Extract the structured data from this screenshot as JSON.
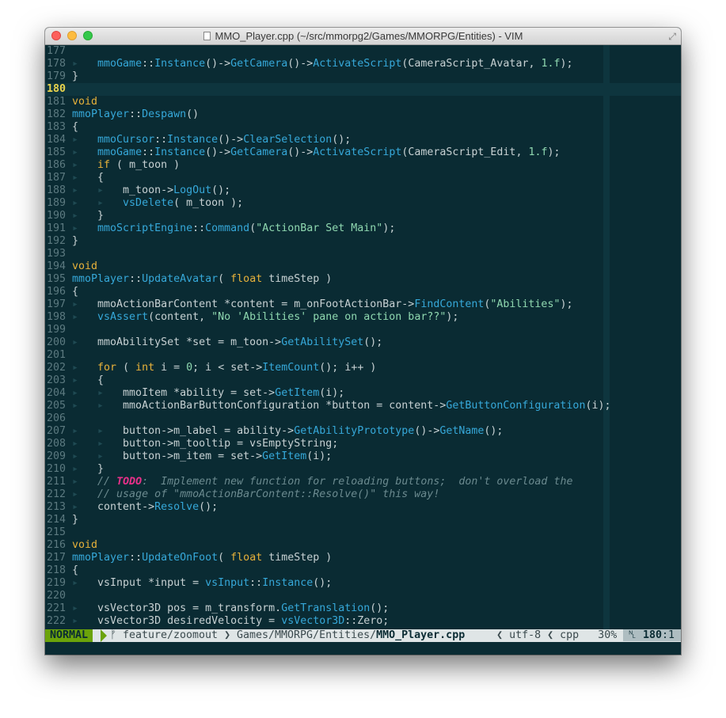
{
  "window": {
    "title": "MMO_Player.cpp (~/src/mmorpg2/Games/MMORPG/Entities) - VIM"
  },
  "icons": {
    "file": "document-icon",
    "fullscreen": "fullscreen-icon",
    "branch": "git-branch-icon",
    "line_number": "line-number-icon"
  },
  "colors": {
    "background": "#0a2b33",
    "keyword": "#e8b23a",
    "identifier": "#36a8d9",
    "string": "#8fd8b0",
    "comment": "#6b8a8f",
    "todo": "#e8308a",
    "mode_normal": "#6ba30a",
    "current_line_number": "#e8d44d"
  },
  "editor": {
    "current_line": 180,
    "lines": [
      {
        "n": "177",
        "t": []
      },
      {
        "n": "178",
        "t": [
          [
            "g",
            "▸   "
          ],
          [
            "cl",
            "mmoGame"
          ],
          [
            "op",
            "::"
          ],
          [
            "fn",
            "Instance"
          ],
          [
            "op",
            "()->"
          ],
          [
            "fn",
            "GetCamera"
          ],
          [
            "op",
            "()->"
          ],
          [
            "fn",
            "ActivateScript"
          ],
          [
            "op",
            "(CameraScript_Avatar, "
          ],
          [
            "numl",
            "1.f"
          ],
          [
            "op",
            ");"
          ]
        ]
      },
      {
        "n": "179",
        "t": [
          [
            "op",
            "}"
          ]
        ]
      },
      {
        "n": "180",
        "t": []
      },
      {
        "n": "181",
        "t": [
          [
            "ty",
            "void"
          ]
        ]
      },
      {
        "n": "182",
        "t": [
          [
            "cl",
            "mmoPlayer"
          ],
          [
            "op",
            "::"
          ],
          [
            "fn",
            "Despawn"
          ],
          [
            "op",
            "()"
          ]
        ]
      },
      {
        "n": "183",
        "t": [
          [
            "op",
            "{"
          ]
        ]
      },
      {
        "n": "184",
        "t": [
          [
            "g",
            "▸   "
          ],
          [
            "cl",
            "mmoCursor"
          ],
          [
            "op",
            "::"
          ],
          [
            "fn",
            "Instance"
          ],
          [
            "op",
            "()->"
          ],
          [
            "fn",
            "ClearSelection"
          ],
          [
            "op",
            "();"
          ]
        ]
      },
      {
        "n": "185",
        "t": [
          [
            "g",
            "▸   "
          ],
          [
            "cl",
            "mmoGame"
          ],
          [
            "op",
            "::"
          ],
          [
            "fn",
            "Instance"
          ],
          [
            "op",
            "()->"
          ],
          [
            "fn",
            "GetCamera"
          ],
          [
            "op",
            "()->"
          ],
          [
            "fn",
            "ActivateScript"
          ],
          [
            "op",
            "(CameraScript_Edit, "
          ],
          [
            "numl",
            "1.f"
          ],
          [
            "op",
            ");"
          ]
        ]
      },
      {
        "n": "186",
        "t": [
          [
            "g",
            "▸   "
          ],
          [
            "kw",
            "if"
          ],
          [
            "op",
            " ( m_toon )"
          ]
        ]
      },
      {
        "n": "187",
        "t": [
          [
            "g",
            "▸   "
          ],
          [
            "op",
            "{"
          ]
        ]
      },
      {
        "n": "188",
        "t": [
          [
            "g",
            "▸   ▸   "
          ],
          [
            "op",
            "m_toon->"
          ],
          [
            "fn",
            "LogOut"
          ],
          [
            "op",
            "();"
          ]
        ]
      },
      {
        "n": "189",
        "t": [
          [
            "g",
            "▸   ▸   "
          ],
          [
            "fn",
            "vsDelete"
          ],
          [
            "op",
            "( m_toon );"
          ]
        ]
      },
      {
        "n": "190",
        "t": [
          [
            "g",
            "▸   "
          ],
          [
            "op",
            "}"
          ]
        ]
      },
      {
        "n": "191",
        "t": [
          [
            "g",
            "▸   "
          ],
          [
            "cl",
            "mmoScriptEngine"
          ],
          [
            "op",
            "::"
          ],
          [
            "fn",
            "Command"
          ],
          [
            "op",
            "("
          ],
          [
            "str",
            "\"ActionBar Set Main\""
          ],
          [
            "op",
            ");"
          ]
        ]
      },
      {
        "n": "192",
        "t": [
          [
            "op",
            "}"
          ]
        ]
      },
      {
        "n": "193",
        "t": []
      },
      {
        "n": "194",
        "t": [
          [
            "ty",
            "void"
          ]
        ]
      },
      {
        "n": "195",
        "t": [
          [
            "cl",
            "mmoPlayer"
          ],
          [
            "op",
            "::"
          ],
          [
            "fn",
            "UpdateAvatar"
          ],
          [
            "op",
            "( "
          ],
          [
            "ty",
            "float"
          ],
          [
            "op",
            " timeStep )"
          ]
        ]
      },
      {
        "n": "196",
        "t": [
          [
            "op",
            "{"
          ]
        ]
      },
      {
        "n": "197",
        "t": [
          [
            "g",
            "▸   "
          ],
          [
            "op",
            "mmoActionBarContent *content = m_onFootActionBar->"
          ],
          [
            "fn",
            "FindContent"
          ],
          [
            "op",
            "("
          ],
          [
            "str",
            "\"Abilities\""
          ],
          [
            "op",
            ");"
          ]
        ]
      },
      {
        "n": "198",
        "t": [
          [
            "g",
            "▸   "
          ],
          [
            "fn",
            "vsAssert"
          ],
          [
            "op",
            "(content, "
          ],
          [
            "str",
            "\"No 'Abilities' pane on action bar??\""
          ],
          [
            "op",
            ");"
          ]
        ]
      },
      {
        "n": "199",
        "t": []
      },
      {
        "n": "200",
        "t": [
          [
            "g",
            "▸   "
          ],
          [
            "op",
            "mmoAbilitySet *set = m_toon->"
          ],
          [
            "fn",
            "GetAbilitySet"
          ],
          [
            "op",
            "();"
          ]
        ]
      },
      {
        "n": "201",
        "t": []
      },
      {
        "n": "202",
        "t": [
          [
            "g",
            "▸   "
          ],
          [
            "kw",
            "for"
          ],
          [
            "op",
            " ( "
          ],
          [
            "ty",
            "int"
          ],
          [
            "op",
            " i = "
          ],
          [
            "numl",
            "0"
          ],
          [
            "op",
            "; i < set->"
          ],
          [
            "fn",
            "ItemCount"
          ],
          [
            "op",
            "(); i++ )"
          ]
        ]
      },
      {
        "n": "203",
        "t": [
          [
            "g",
            "▸   "
          ],
          [
            "op",
            "{"
          ]
        ]
      },
      {
        "n": "204",
        "t": [
          [
            "g",
            "▸   ▸   "
          ],
          [
            "op",
            "mmoItem *ability = set->"
          ],
          [
            "fn",
            "GetItem"
          ],
          [
            "op",
            "(i);"
          ]
        ]
      },
      {
        "n": "205",
        "t": [
          [
            "g",
            "▸   ▸   "
          ],
          [
            "op",
            "mmoActionBarButtonConfiguration *button = content->"
          ],
          [
            "fn",
            "GetButtonConfiguration"
          ],
          [
            "op",
            "(i);"
          ]
        ]
      },
      {
        "n": "206",
        "t": []
      },
      {
        "n": "207",
        "t": [
          [
            "g",
            "▸   ▸   "
          ],
          [
            "op",
            "button->m_label = ability->"
          ],
          [
            "fn",
            "GetAbilityPrototype"
          ],
          [
            "op",
            "()->"
          ],
          [
            "fn",
            "GetName"
          ],
          [
            "op",
            "();"
          ]
        ]
      },
      {
        "n": "208",
        "t": [
          [
            "g",
            "▸   ▸   "
          ],
          [
            "op",
            "button->m_tooltip = vsEmptyString;"
          ]
        ]
      },
      {
        "n": "209",
        "t": [
          [
            "g",
            "▸   ▸   "
          ],
          [
            "op",
            "button->m_item = set->"
          ],
          [
            "fn",
            "GetItem"
          ],
          [
            "op",
            "(i);"
          ]
        ]
      },
      {
        "n": "210",
        "t": [
          [
            "g",
            "▸   "
          ],
          [
            "op",
            "}"
          ]
        ]
      },
      {
        "n": "211",
        "t": [
          [
            "g",
            "▸   "
          ],
          [
            "cm",
            "// "
          ],
          [
            "todo",
            "TODO"
          ],
          [
            "cm",
            ":  Implement new function for reloading buttons;  don't overload the"
          ]
        ]
      },
      {
        "n": "212",
        "t": [
          [
            "g",
            "▸   "
          ],
          [
            "cm",
            "// usage of \"mmoActionBarContent::Resolve()\" this way!"
          ]
        ]
      },
      {
        "n": "213",
        "t": [
          [
            "g",
            "▸   "
          ],
          [
            "op",
            "content->"
          ],
          [
            "fn",
            "Resolve"
          ],
          [
            "op",
            "();"
          ]
        ]
      },
      {
        "n": "214",
        "t": [
          [
            "op",
            "}"
          ]
        ]
      },
      {
        "n": "215",
        "t": []
      },
      {
        "n": "216",
        "t": [
          [
            "ty",
            "void"
          ]
        ]
      },
      {
        "n": "217",
        "t": [
          [
            "cl",
            "mmoPlayer"
          ],
          [
            "op",
            "::"
          ],
          [
            "fn",
            "UpdateOnFoot"
          ],
          [
            "op",
            "( "
          ],
          [
            "ty",
            "float"
          ],
          [
            "op",
            " timeStep )"
          ]
        ]
      },
      {
        "n": "218",
        "t": [
          [
            "op",
            "{"
          ]
        ]
      },
      {
        "n": "219",
        "t": [
          [
            "g",
            "▸   "
          ],
          [
            "op",
            "vsInput *input = "
          ],
          [
            "cl",
            "vsInput"
          ],
          [
            "op",
            "::"
          ],
          [
            "fn",
            "Instance"
          ],
          [
            "op",
            "();"
          ]
        ]
      },
      {
        "n": "220",
        "t": []
      },
      {
        "n": "221",
        "t": [
          [
            "g",
            "▸   "
          ],
          [
            "op",
            "vsVector3D pos = m_transform."
          ],
          [
            "fn",
            "GetTranslation"
          ],
          [
            "op",
            "();"
          ]
        ]
      },
      {
        "n": "222",
        "t": [
          [
            "g",
            "▸   "
          ],
          [
            "op",
            "vsVector3D desiredVelocity = "
          ],
          [
            "cl",
            "vsVector3D"
          ],
          [
            "op",
            "::Zero;"
          ]
        ]
      }
    ]
  },
  "statusline": {
    "mode": "NORMAL",
    "branch": "feature/zoomout",
    "path_dir": "Games/MMORPG/Entities/",
    "path_file": "MMO_Player.cpp",
    "encoding": "utf-8",
    "filetype": "cpp",
    "percent": "30%",
    "line": "180",
    "col": "1"
  }
}
